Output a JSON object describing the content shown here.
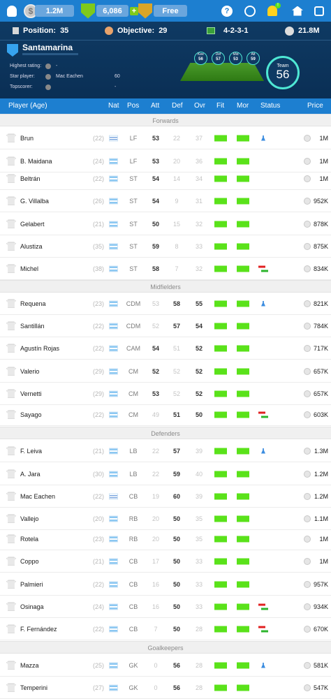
{
  "topbar": {
    "cash": "1.2M",
    "gems": "6,086",
    "gem_plus": "+",
    "free_label": "Free",
    "coin_glyph": "$",
    "icons": [
      "help-icon",
      "timer-icon",
      "bell-icon",
      "home-icon",
      "profile-icon"
    ],
    "bell_badge": "!"
  },
  "header": {
    "position_label": "Position:",
    "position_value": "35",
    "objective_label": "Objective:",
    "objective_value": "29",
    "formation": "4-2-3-1",
    "budget": "21.8M",
    "team_name": "Santamarina",
    "highest_rating_label": "Highest rating:",
    "highest_rating_value": "-",
    "star_player_label": "Star player:",
    "star_player_name": "Mac Eachen",
    "star_player_value": "60",
    "topscorer_label": "Topscorer:",
    "topscorer_value": "-",
    "ratings": [
      {
        "label": "Kee",
        "value": "56"
      },
      {
        "label": "Def",
        "value": "57"
      },
      {
        "label": "Mid",
        "value": "53"
      },
      {
        "label": "Att",
        "value": "59"
      }
    ],
    "team_label": "Team",
    "team_value": "56"
  },
  "columns": {
    "player": "Player (Age)",
    "nat": "Nat",
    "pos": "Pos",
    "att": "Att",
    "def": "Def",
    "ovr": "Ovr",
    "fit": "Fit",
    "mor": "Mor",
    "status": "Status",
    "price": "Price"
  },
  "sections": [
    "Forwards",
    "Midfielders",
    "Defenders",
    "Goalkeepers"
  ],
  "players": [
    {
      "name": "Brun",
      "age": "(22)",
      "nat": "uru",
      "pos": "LF",
      "att": "53",
      "def": "22",
      "ovr": "37",
      "status": "training",
      "price": "1M"
    },
    {
      "name": "B. Maidana",
      "age": "(24)",
      "nat": "arg",
      "pos": "LF",
      "att": "53",
      "def": "20",
      "ovr": "36",
      "status": "",
      "price": "1M"
    },
    {
      "name": "Beltrán",
      "age": "(22)",
      "nat": "arg",
      "pos": "ST",
      "att": "54",
      "def": "14",
      "ovr": "34",
      "status": "",
      "price": "1M"
    },
    {
      "name": "G. Villalba",
      "age": "(26)",
      "nat": "arg",
      "pos": "ST",
      "att": "54",
      "def": "9",
      "ovr": "31",
      "status": "",
      "price": "952K"
    },
    {
      "name": "Gelabert",
      "age": "(21)",
      "nat": "arg",
      "pos": "ST",
      "att": "50",
      "def": "15",
      "ovr": "32",
      "status": "",
      "price": "878K"
    },
    {
      "name": "Alustiza",
      "age": "(35)",
      "nat": "arg",
      "pos": "ST",
      "att": "59",
      "def": "8",
      "ovr": "33",
      "status": "",
      "price": "875K"
    },
    {
      "name": "Michel",
      "age": "(38)",
      "nat": "arg",
      "pos": "ST",
      "att": "58",
      "def": "7",
      "ovr": "32",
      "status": "transfer",
      "price": "834K"
    },
    {
      "name": "Requena",
      "age": "(23)",
      "nat": "arg",
      "pos": "CDM",
      "att": "53",
      "def": "58",
      "ovr": "55",
      "status": "training",
      "price": "821K"
    },
    {
      "name": "Santillán",
      "age": "(22)",
      "nat": "arg",
      "pos": "CDM",
      "att": "52",
      "def": "57",
      "ovr": "54",
      "status": "",
      "price": "784K"
    },
    {
      "name": "Agustín Rojas",
      "age": "(22)",
      "nat": "arg",
      "pos": "CAM",
      "att": "54",
      "def": "51",
      "ovr": "52",
      "status": "",
      "price": "717K"
    },
    {
      "name": "Valerio",
      "age": "(29)",
      "nat": "arg",
      "pos": "CM",
      "att": "52",
      "def": "52",
      "ovr": "52",
      "status": "",
      "price": "657K"
    },
    {
      "name": "Vernetti",
      "age": "(29)",
      "nat": "arg",
      "pos": "CM",
      "att": "53",
      "def": "52",
      "ovr": "52",
      "status": "",
      "price": "657K"
    },
    {
      "name": "Sayago",
      "age": "(22)",
      "nat": "arg",
      "pos": "CM",
      "att": "49",
      "def": "51",
      "ovr": "50",
      "status": "transfer",
      "price": "603K"
    },
    {
      "name": "F. Leiva",
      "age": "(21)",
      "nat": "arg",
      "pos": "LB",
      "att": "22",
      "def": "57",
      "ovr": "39",
      "status": "training",
      "price": "1.3M"
    },
    {
      "name": "A. Jara",
      "age": "(30)",
      "nat": "arg",
      "pos": "LB",
      "att": "22",
      "def": "59",
      "ovr": "40",
      "status": "",
      "price": "1.2M"
    },
    {
      "name": "Mac Eachen",
      "age": "(22)",
      "nat": "uru",
      "pos": "CB",
      "att": "19",
      "def": "60",
      "ovr": "39",
      "status": "",
      "price": "1.2M"
    },
    {
      "name": "Vallejo",
      "age": "(20)",
      "nat": "arg",
      "pos": "RB",
      "att": "20",
      "def": "50",
      "ovr": "35",
      "status": "",
      "price": "1.1M"
    },
    {
      "name": "Rotela",
      "age": "(23)",
      "nat": "arg",
      "pos": "RB",
      "att": "20",
      "def": "50",
      "ovr": "35",
      "status": "",
      "price": "1M"
    },
    {
      "name": "Coppo",
      "age": "(21)",
      "nat": "arg",
      "pos": "CB",
      "att": "17",
      "def": "50",
      "ovr": "33",
      "status": "",
      "price": "1M"
    },
    {
      "name": "Palmieri",
      "age": "(22)",
      "nat": "arg",
      "pos": "CB",
      "att": "16",
      "def": "50",
      "ovr": "33",
      "status": "",
      "price": "957K"
    },
    {
      "name": "Osinaga",
      "age": "(24)",
      "nat": "arg",
      "pos": "CB",
      "att": "16",
      "def": "50",
      "ovr": "33",
      "status": "transfer",
      "price": "934K"
    },
    {
      "name": "F. Fernández",
      "age": "(22)",
      "nat": "arg",
      "pos": "CB",
      "att": "7",
      "def": "50",
      "ovr": "28",
      "status": "transfer",
      "price": "670K"
    },
    {
      "name": "Mazza",
      "age": "(25)",
      "nat": "arg",
      "pos": "GK",
      "att": "0",
      "def": "56",
      "ovr": "28",
      "status": "training",
      "price": "581K"
    },
    {
      "name": "Temperini",
      "age": "(27)",
      "nat": "arg",
      "pos": "GK",
      "att": "0",
      "def": "56",
      "ovr": "28",
      "status": "",
      "price": "547K"
    }
  ],
  "colors": {
    "accent": "#1d7fd0",
    "panel": "#0f3a63",
    "bar_green": "#5ae21a"
  }
}
